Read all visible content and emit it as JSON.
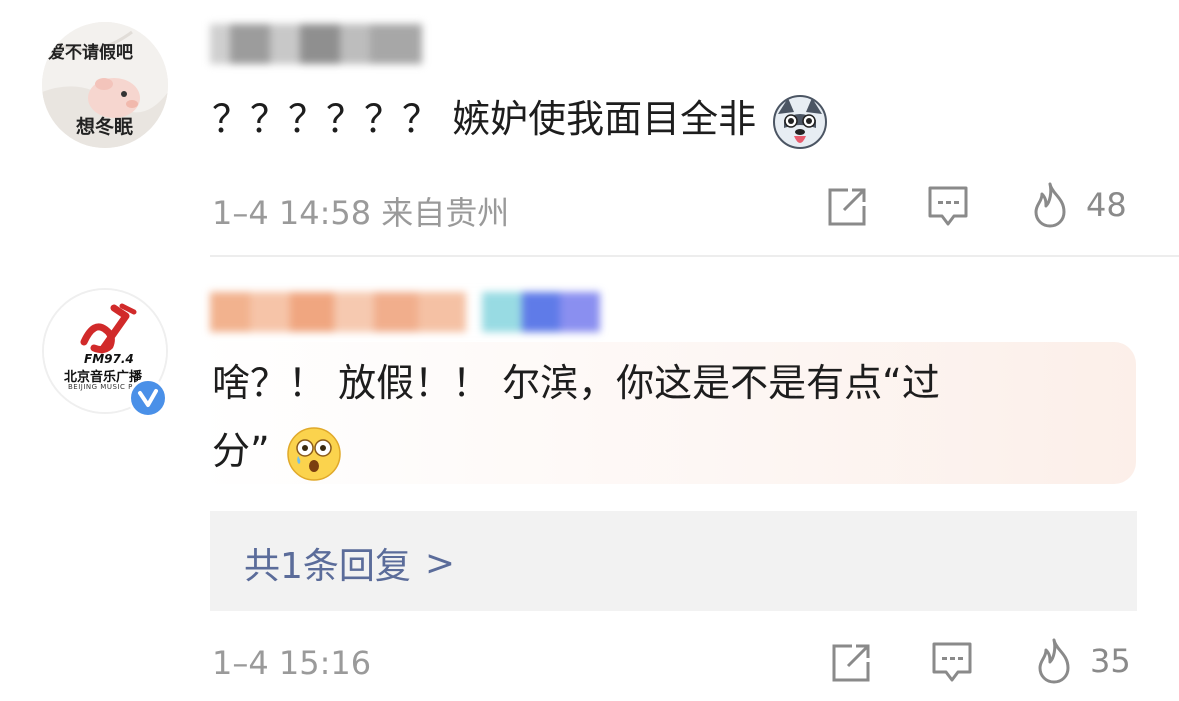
{
  "comments": [
    {
      "avatar_text_top": "爱不请假吧",
      "avatar_text_bottom": "想冬眠",
      "username": "",
      "text": "？？？？？？ 嫉妒使我面目全非",
      "emoji": "husky-emoji",
      "time": "1–4 14:58 来自贵州",
      "like_count": "48"
    },
    {
      "avatar_text_fm": "FM97.4",
      "avatar_text_cn": "北京音乐广播",
      "avatar_text_en": "BEIJING MUSIC RADIO",
      "username": "",
      "verified": true,
      "text_line1": "啥？！ 放假！！ 尔滨，你这是不是有点“过",
      "text_line2": "分”",
      "emoji": "shocked-emoji",
      "reply_link": "共1条回复",
      "reply_chevron": ">",
      "time": "1–4 15:16",
      "like_count": "35"
    }
  ],
  "colors": {
    "link": "#5b6c9a",
    "meta": "#9a9a9a",
    "verified": "#4a90e8",
    "reply_bg": "#f2f2f2"
  }
}
